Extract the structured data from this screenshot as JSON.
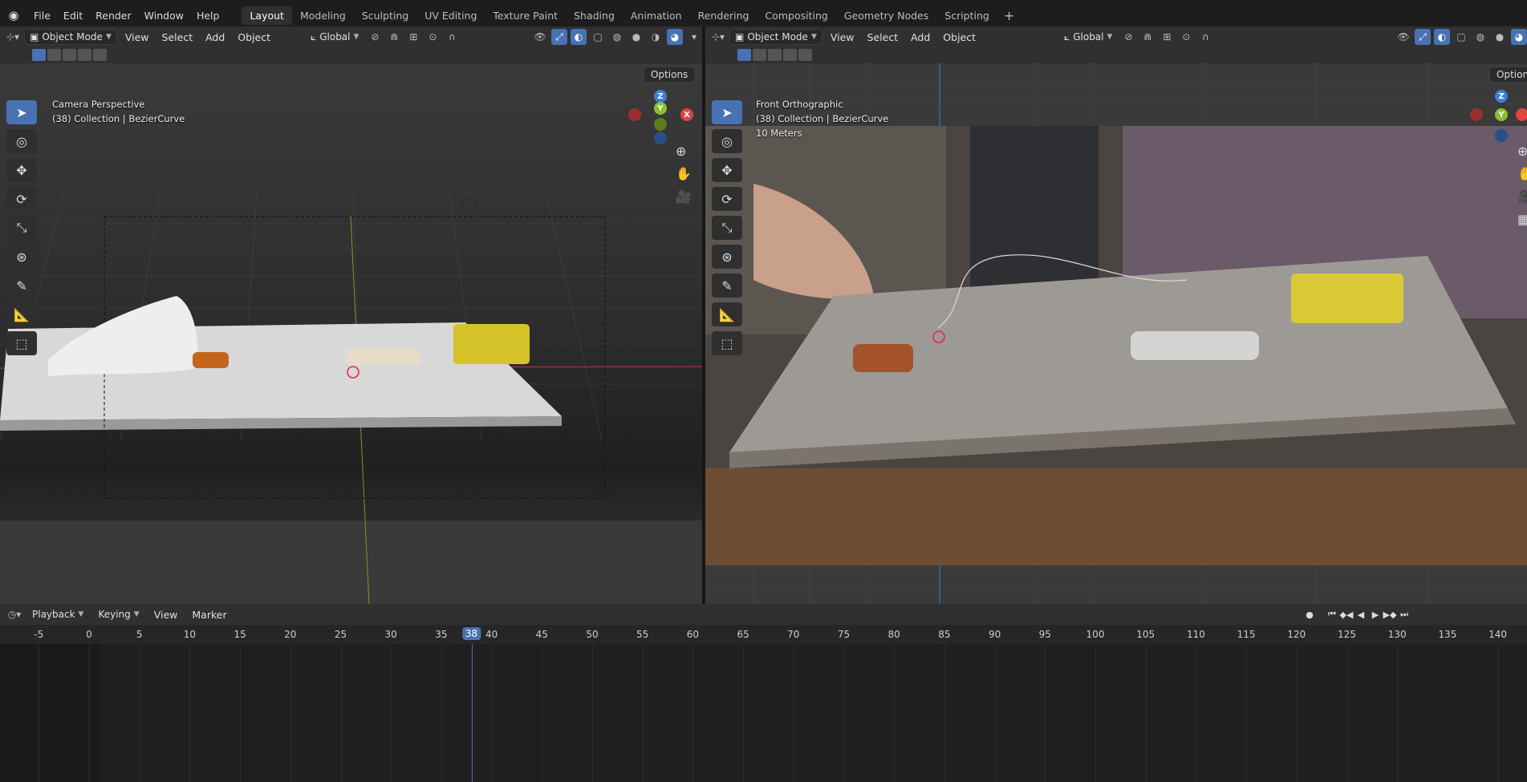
{
  "topbar": {
    "menus": [
      "File",
      "Edit",
      "Render",
      "Window",
      "Help"
    ],
    "workspaces": [
      "Layout",
      "Modeling",
      "Sculpting",
      "UV Editing",
      "Texture Paint",
      "Shading",
      "Animation",
      "Rendering",
      "Compositing",
      "Geometry Nodes",
      "Scripting"
    ],
    "active_workspace": "Layout",
    "add_symbol": "+"
  },
  "left_view": {
    "mode": "Object Mode",
    "menus": [
      "View",
      "Select",
      "Add",
      "Object"
    ],
    "orientation": "Global",
    "options_label": "Options",
    "info_line1": "Camera Perspective",
    "info_line2": "(38) Collection | BezierCurve"
  },
  "right_view": {
    "mode": "Object Mode",
    "menus": [
      "View",
      "Select",
      "Add",
      "Object"
    ],
    "orientation": "Global",
    "options_label": "Options",
    "info_line1": "Front Orthographic",
    "info_line2": "(38) Collection | BezierCurve",
    "info_line3": "10 Meters"
  },
  "gizmo": {
    "x": "X",
    "y": "Y",
    "z": "Z"
  },
  "timeline": {
    "menus": [
      "Playback",
      "Keying",
      "View",
      "Marker"
    ],
    "current_frame": "38",
    "ticks": [
      "-5",
      "0",
      "5",
      "10",
      "15",
      "20",
      "25",
      "30",
      "35",
      "40",
      "45",
      "50",
      "55",
      "60",
      "65",
      "70",
      "75",
      "80",
      "85",
      "90",
      "95",
      "100",
      "105",
      "110",
      "115",
      "120",
      "125",
      "130",
      "135",
      "140"
    ]
  },
  "colors": {
    "accent": "#4772b3",
    "x_axis": "#e2433f",
    "y_axis": "#8bc12f",
    "z_axis": "#3d7fd9"
  }
}
